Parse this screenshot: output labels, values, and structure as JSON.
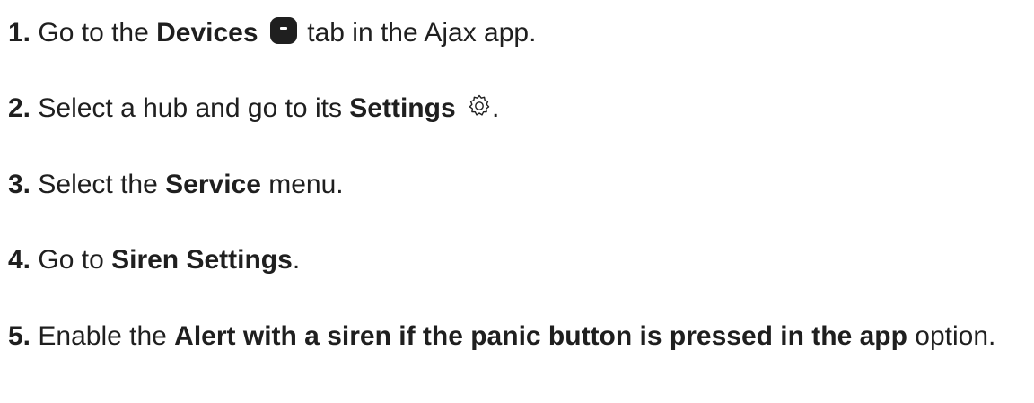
{
  "steps": [
    {
      "number": "1.",
      "before": "Go to the ",
      "bold": "Devices",
      "icon": "devices-icon",
      "after": " tab in the Ajax app."
    },
    {
      "number": "2.",
      "before": "Select a hub and go to its ",
      "bold": "Settings",
      "icon": "gear-icon",
      "after": "."
    },
    {
      "number": "3.",
      "before": "Select the ",
      "bold": "Service",
      "after": " menu."
    },
    {
      "number": "4.",
      "before": "Go to ",
      "bold": "Siren Settings",
      "after": "."
    },
    {
      "number": "5.",
      "before": "Enable the ",
      "bold": "Alert with a siren if the panic button is pressed in the app",
      "after": " option."
    }
  ]
}
